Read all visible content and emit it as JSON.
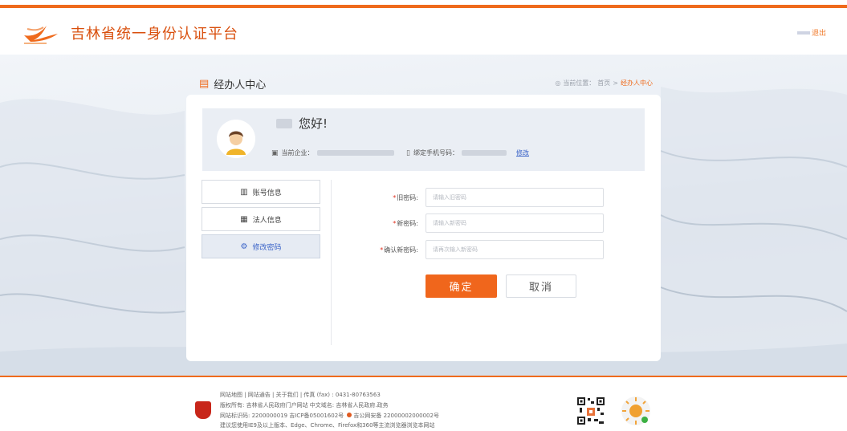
{
  "header": {
    "title": "吉林省统一身份认证平台",
    "logout_label": "退出"
  },
  "breadcrumb": {
    "page_title": "经办人中心",
    "location_label": "当前位置：",
    "home": "首页",
    "separator": ">",
    "current": "经办人中心"
  },
  "welcome": {
    "greeting": "您好!",
    "company_label": "当前企业：",
    "phone_label": "绑定手机号码：",
    "modify_link": "修改"
  },
  "menu": {
    "items": [
      {
        "label": "账号信息",
        "icon": "building-icon",
        "active": false
      },
      {
        "label": "法人信息",
        "icon": "id-card-icon",
        "active": false
      },
      {
        "label": "修改密码",
        "icon": "gear-icon",
        "active": true
      }
    ]
  },
  "form": {
    "old_password": {
      "label": "旧密码:",
      "placeholder": "请输入旧密码",
      "value": ""
    },
    "new_password": {
      "label": "新密码:",
      "placeholder": "请输入新密码",
      "value": ""
    },
    "confirm_password": {
      "label": "确认新密码:",
      "placeholder": "请再次输入新密码",
      "value": ""
    },
    "confirm_button": "确定",
    "cancel_button": "取消"
  },
  "footer": {
    "line1": "网站地图 | 网站通告 | 关于我们 | 传真 (fax) : 0431-80763563",
    "line2": "版权所有: 吉林省人民政府门户网站 中文域名: 吉林省人民政府.政务",
    "line3a": "网站标识码: 2200000019 吉ICP备05001602号",
    "line3b": "吉公网安备 22000002000002号",
    "line4": "建议您使用IE9及以上版本、Edge、Chrome、Firefox和360等主流浏览器浏览本网站"
  },
  "colors": {
    "brand_orange": "#ef6a1c",
    "link_blue": "#3a63c8",
    "required_red": "#e0301e"
  }
}
